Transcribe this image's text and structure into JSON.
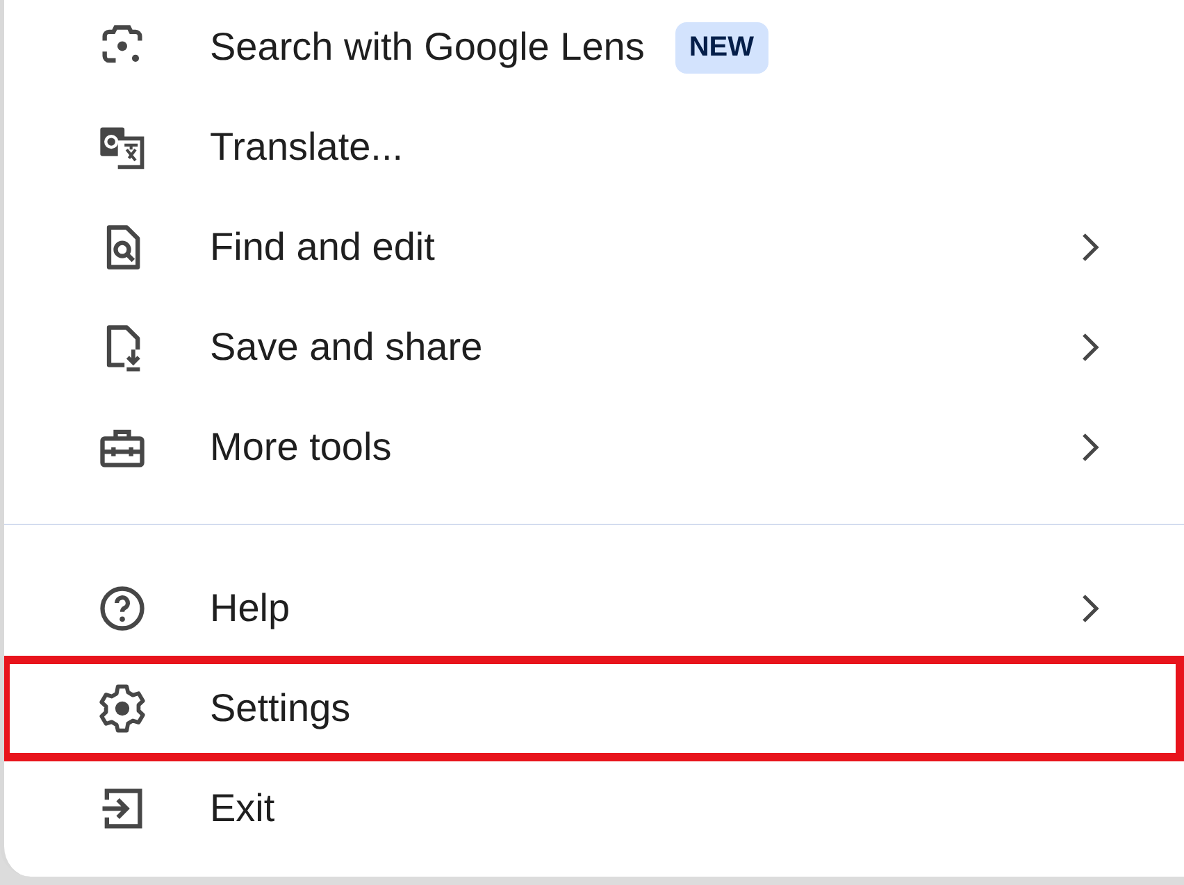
{
  "menu": {
    "groups": [
      {
        "items": [
          {
            "label": "Search with Google Lens",
            "badge": "NEW",
            "submenu": false,
            "highlighted": false
          },
          {
            "label": "Translate...",
            "submenu": false,
            "highlighted": false
          },
          {
            "label": "Find and edit",
            "submenu": true,
            "highlighted": false
          },
          {
            "label": "Save and share",
            "submenu": true,
            "highlighted": false
          },
          {
            "label": "More tools",
            "submenu": true,
            "highlighted": false
          }
        ]
      },
      {
        "items": [
          {
            "label": "Help",
            "submenu": true,
            "highlighted": false
          },
          {
            "label": "Settings",
            "submenu": false,
            "highlighted": true
          },
          {
            "label": "Exit",
            "submenu": false,
            "highlighted": false
          }
        ]
      }
    ]
  }
}
